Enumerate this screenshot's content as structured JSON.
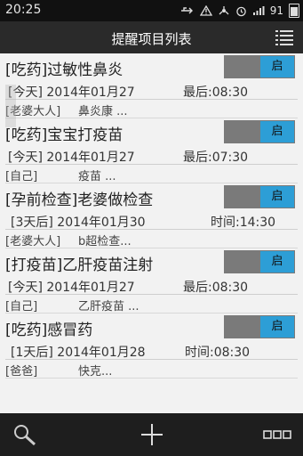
{
  "status_bar": {
    "time": "20:25",
    "battery": "91"
  },
  "header": {
    "title": "提醒项目列表"
  },
  "items": [
    {
      "title": "[吃药]过敏性鼻炎",
      "toggle": "启",
      "when": "[今天] 2014年01月27",
      "last": "最后:08:30",
      "who": "[老婆大人]",
      "detail": "鼻炎康 ..."
    },
    {
      "title": "[吃药]宝宝打疫苗",
      "toggle": "启",
      "when": "[今天] 2014年01月27",
      "last": "最后:07:30",
      "who": "[自己]",
      "detail": "疫苗 ..."
    },
    {
      "title": "[孕前检查]老婆做检查",
      "toggle": "启",
      "when": "[3天后] 2014年01月30",
      "last": "时间:14:30",
      "who": "[老婆大人]",
      "detail": "b超检查..."
    },
    {
      "title": "[打疫苗]乙肝疫苗注射",
      "toggle": "启",
      "when": "[今天] 2014年01月27",
      "last": "最后:08:30",
      "who": "[自己]",
      "detail": "乙肝疫苗 ..."
    },
    {
      "title": "[吃药]感冒药",
      "toggle": "启",
      "when": "[1天后] 2014年01月28",
      "last": "时间:08:30",
      "who": "[爸爸]",
      "detail": "快克..."
    }
  ],
  "icons": {
    "search": "search-icon",
    "add": "add-icon",
    "more": "more-icon",
    "menu": "menu-list-icon"
  },
  "colors": {
    "toggle_on": "#2d9ed6",
    "toggle_off": "#7a7a7a",
    "bar": "#2a2a2a"
  }
}
